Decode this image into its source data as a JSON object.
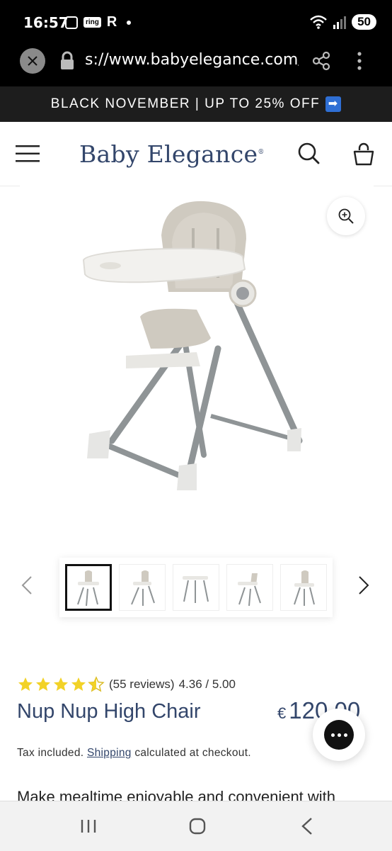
{
  "status_bar": {
    "time": "16:57",
    "ring_label": "ring",
    "r_label": "R",
    "battery": "50"
  },
  "browser": {
    "url": "s://www.babyelegance.com/p"
  },
  "promo": {
    "text": "BLACK NOVEMBER | UP TO 25% OFF",
    "arrow": "➡"
  },
  "header": {
    "logo": "Baby Elegance",
    "logo_mark": "®"
  },
  "product": {
    "rating_text": "(55 reviews)",
    "rating_score": "4.36 / 5.00",
    "rating_value": 4.36,
    "title": "Nup Nup High Chair",
    "price_currency": "€",
    "price_value": "120.00",
    "tax_prefix": "Tax included.",
    "tax_link": "Shipping",
    "tax_suffix": "calculated at checkout.",
    "description_start": "Make mealtime enjoyable and convenient with"
  },
  "thumbnails": {
    "count": 5,
    "active_index": 0
  },
  "colors": {
    "brand_navy": "#33466b",
    "banner_bg": "#1d1d1d",
    "star_yellow": "#f2d227"
  },
  "icons": [
    "close-icon",
    "lock-icon",
    "share-icon",
    "more-icon",
    "menu-icon",
    "search-icon",
    "bag-icon",
    "zoom-icon",
    "chevron-left-icon",
    "chevron-right-icon",
    "chat-icon",
    "recents-icon",
    "home-icon",
    "back-icon"
  ]
}
